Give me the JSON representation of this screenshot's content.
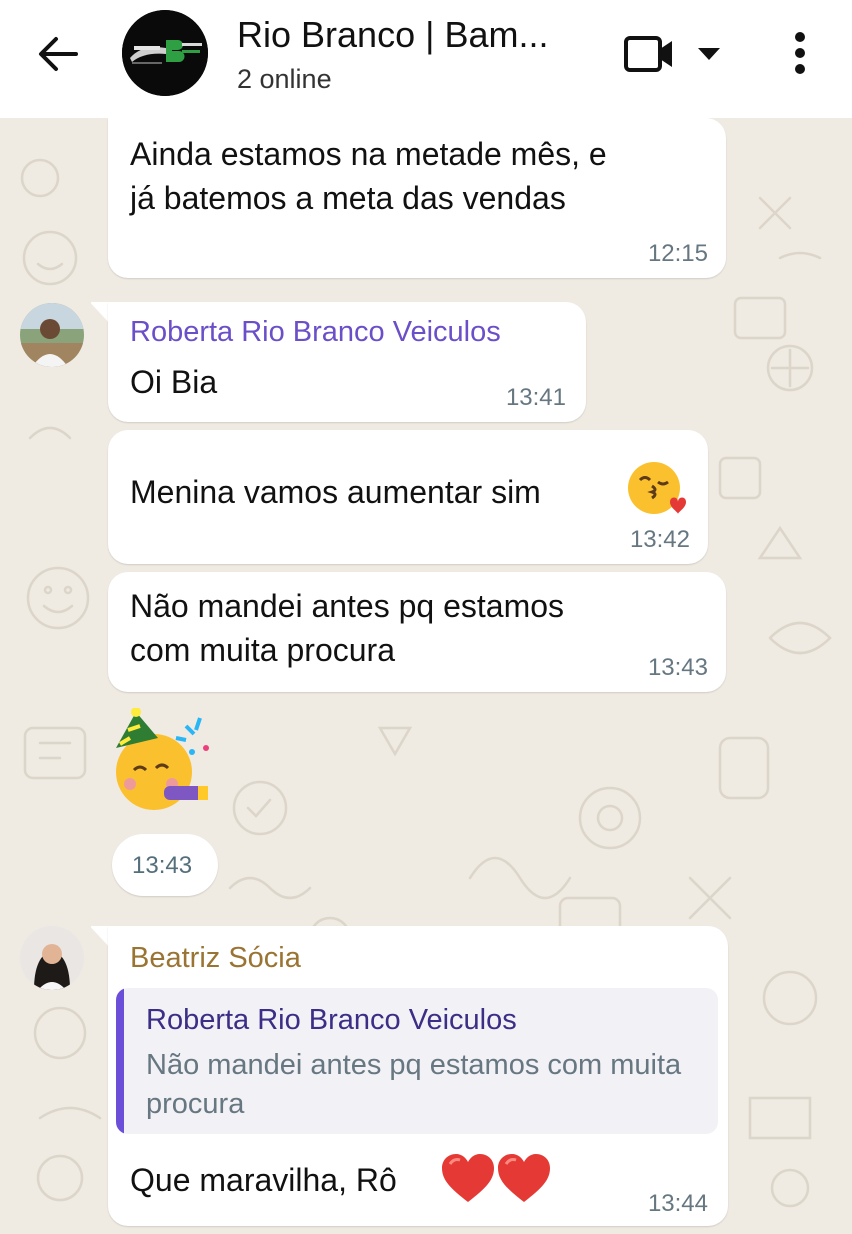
{
  "header": {
    "title": "Rio Branco | Bam...",
    "subtitle": "2 online",
    "accent": "#ffffff"
  },
  "icons": {
    "back": "arrow-left-icon",
    "video": "video-camera-icon",
    "dropdown": "chevron-down-icon",
    "more": "more-vertical-icon"
  },
  "messages": [
    {
      "text_lines": [
        "Ainda estamos na metade mês, e",
        "já batemos a meta das vendas"
      ],
      "time": "12:15"
    },
    {
      "sender": "Roberta Rio Branco Veiculos",
      "sender_color": "#6b4fc8",
      "text": "Oi Bia",
      "time": "13:41"
    },
    {
      "text": "Menina vamos aumentar sim",
      "emoji": "kissing-face-with-heart",
      "time": "13:42"
    },
    {
      "text_lines": [
        "Não mandei antes pq estamos",
        "com muita procura"
      ],
      "time": "13:43"
    },
    {
      "sticker": "partying-face",
      "time": "13:43"
    },
    {
      "sender": "Beatriz Sócia",
      "sender_color": "#9a7432",
      "reply": {
        "name": "Roberta Rio Branco Veiculos",
        "text": "Não mandei antes pq estamos com muita procura"
      },
      "text": "Que maravilha, Rô",
      "emoji": "red-heart x2",
      "time": "13:44"
    }
  ]
}
